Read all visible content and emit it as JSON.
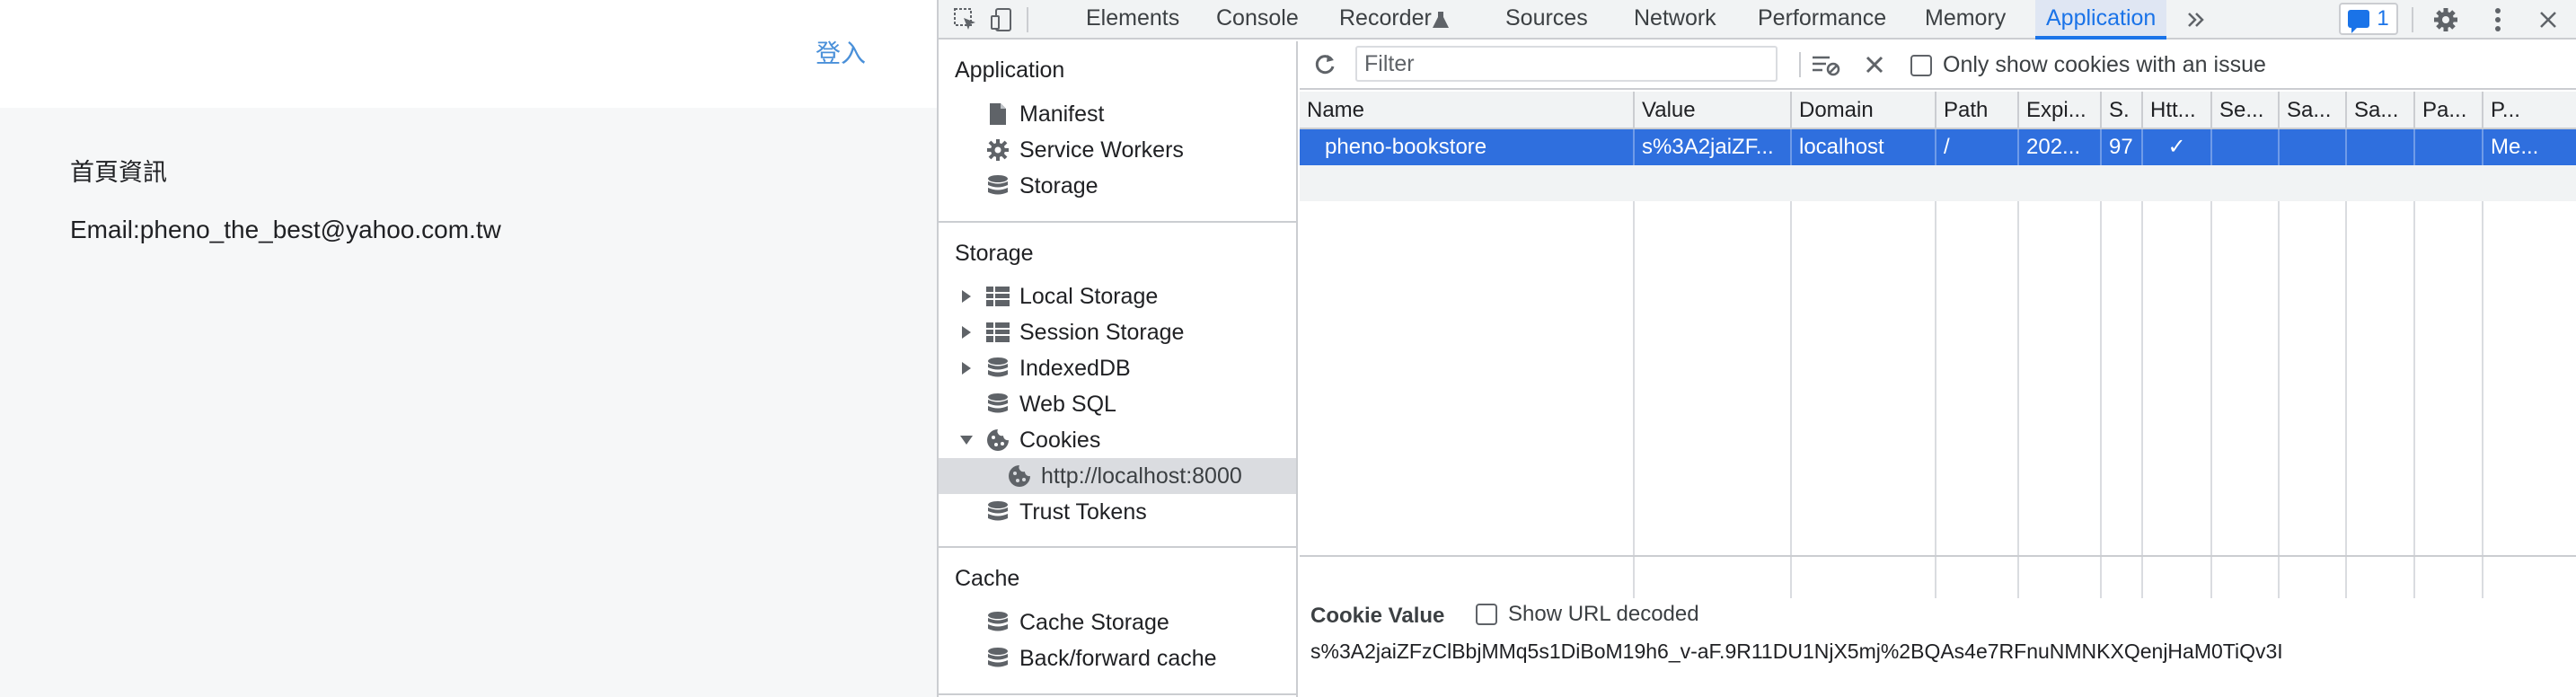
{
  "webpage": {
    "login_label": "登入",
    "heading": "首頁資訊",
    "email_line": "Email:pheno_the_best@yahoo.com.tw"
  },
  "devtools": {
    "tabs": [
      {
        "label": "Elements"
      },
      {
        "label": "Console"
      },
      {
        "label": "Recorder"
      },
      {
        "label": "Sources"
      },
      {
        "label": "Network"
      },
      {
        "label": "Performance"
      },
      {
        "label": "Memory"
      },
      {
        "label": "Application",
        "active": true
      }
    ],
    "issues_count": "1",
    "sidebar": {
      "application_title": "Application",
      "application_items": [
        "Manifest",
        "Service Workers",
        "Storage"
      ],
      "storage_title": "Storage",
      "storage_items": [
        "Local Storage",
        "Session Storage",
        "IndexedDB",
        "Web SQL",
        "Cookies",
        "Trust Tokens"
      ],
      "cookie_origin": "http://localhost:8000",
      "cache_title": "Cache",
      "cache_items": [
        "Cache Storage",
        "Back/forward cache"
      ]
    },
    "filter": {
      "placeholder": "Filter",
      "only_issues_label": "Only show cookies with an issue"
    },
    "table": {
      "columns": [
        "Name",
        "Value",
        "Domain",
        "Path",
        "Expi...",
        "S.",
        "Htt...",
        "Se...",
        "Sa...",
        "Sa...",
        "Pa...",
        "P..."
      ],
      "rows": [
        [
          "pheno-bookstore",
          "s%3A2jaiZF...",
          "localhost",
          "/",
          "202...",
          "97",
          "✓",
          "",
          "",
          "",
          "",
          "Me..."
        ]
      ]
    },
    "cookie_value": {
      "title": "Cookie Value",
      "url_decoded_label": "Show URL decoded",
      "value": "s%3A2jaiZFzClBbjMMq5s1DiBoM19h6_v-aF.9R11DU1NjX5mj%2BQAs4e7RFnuNMNKXQenjHaM0TiQv3I"
    },
    "colors": {
      "accent": "#1a73e8",
      "selected_row": "#2f6fde"
    }
  }
}
